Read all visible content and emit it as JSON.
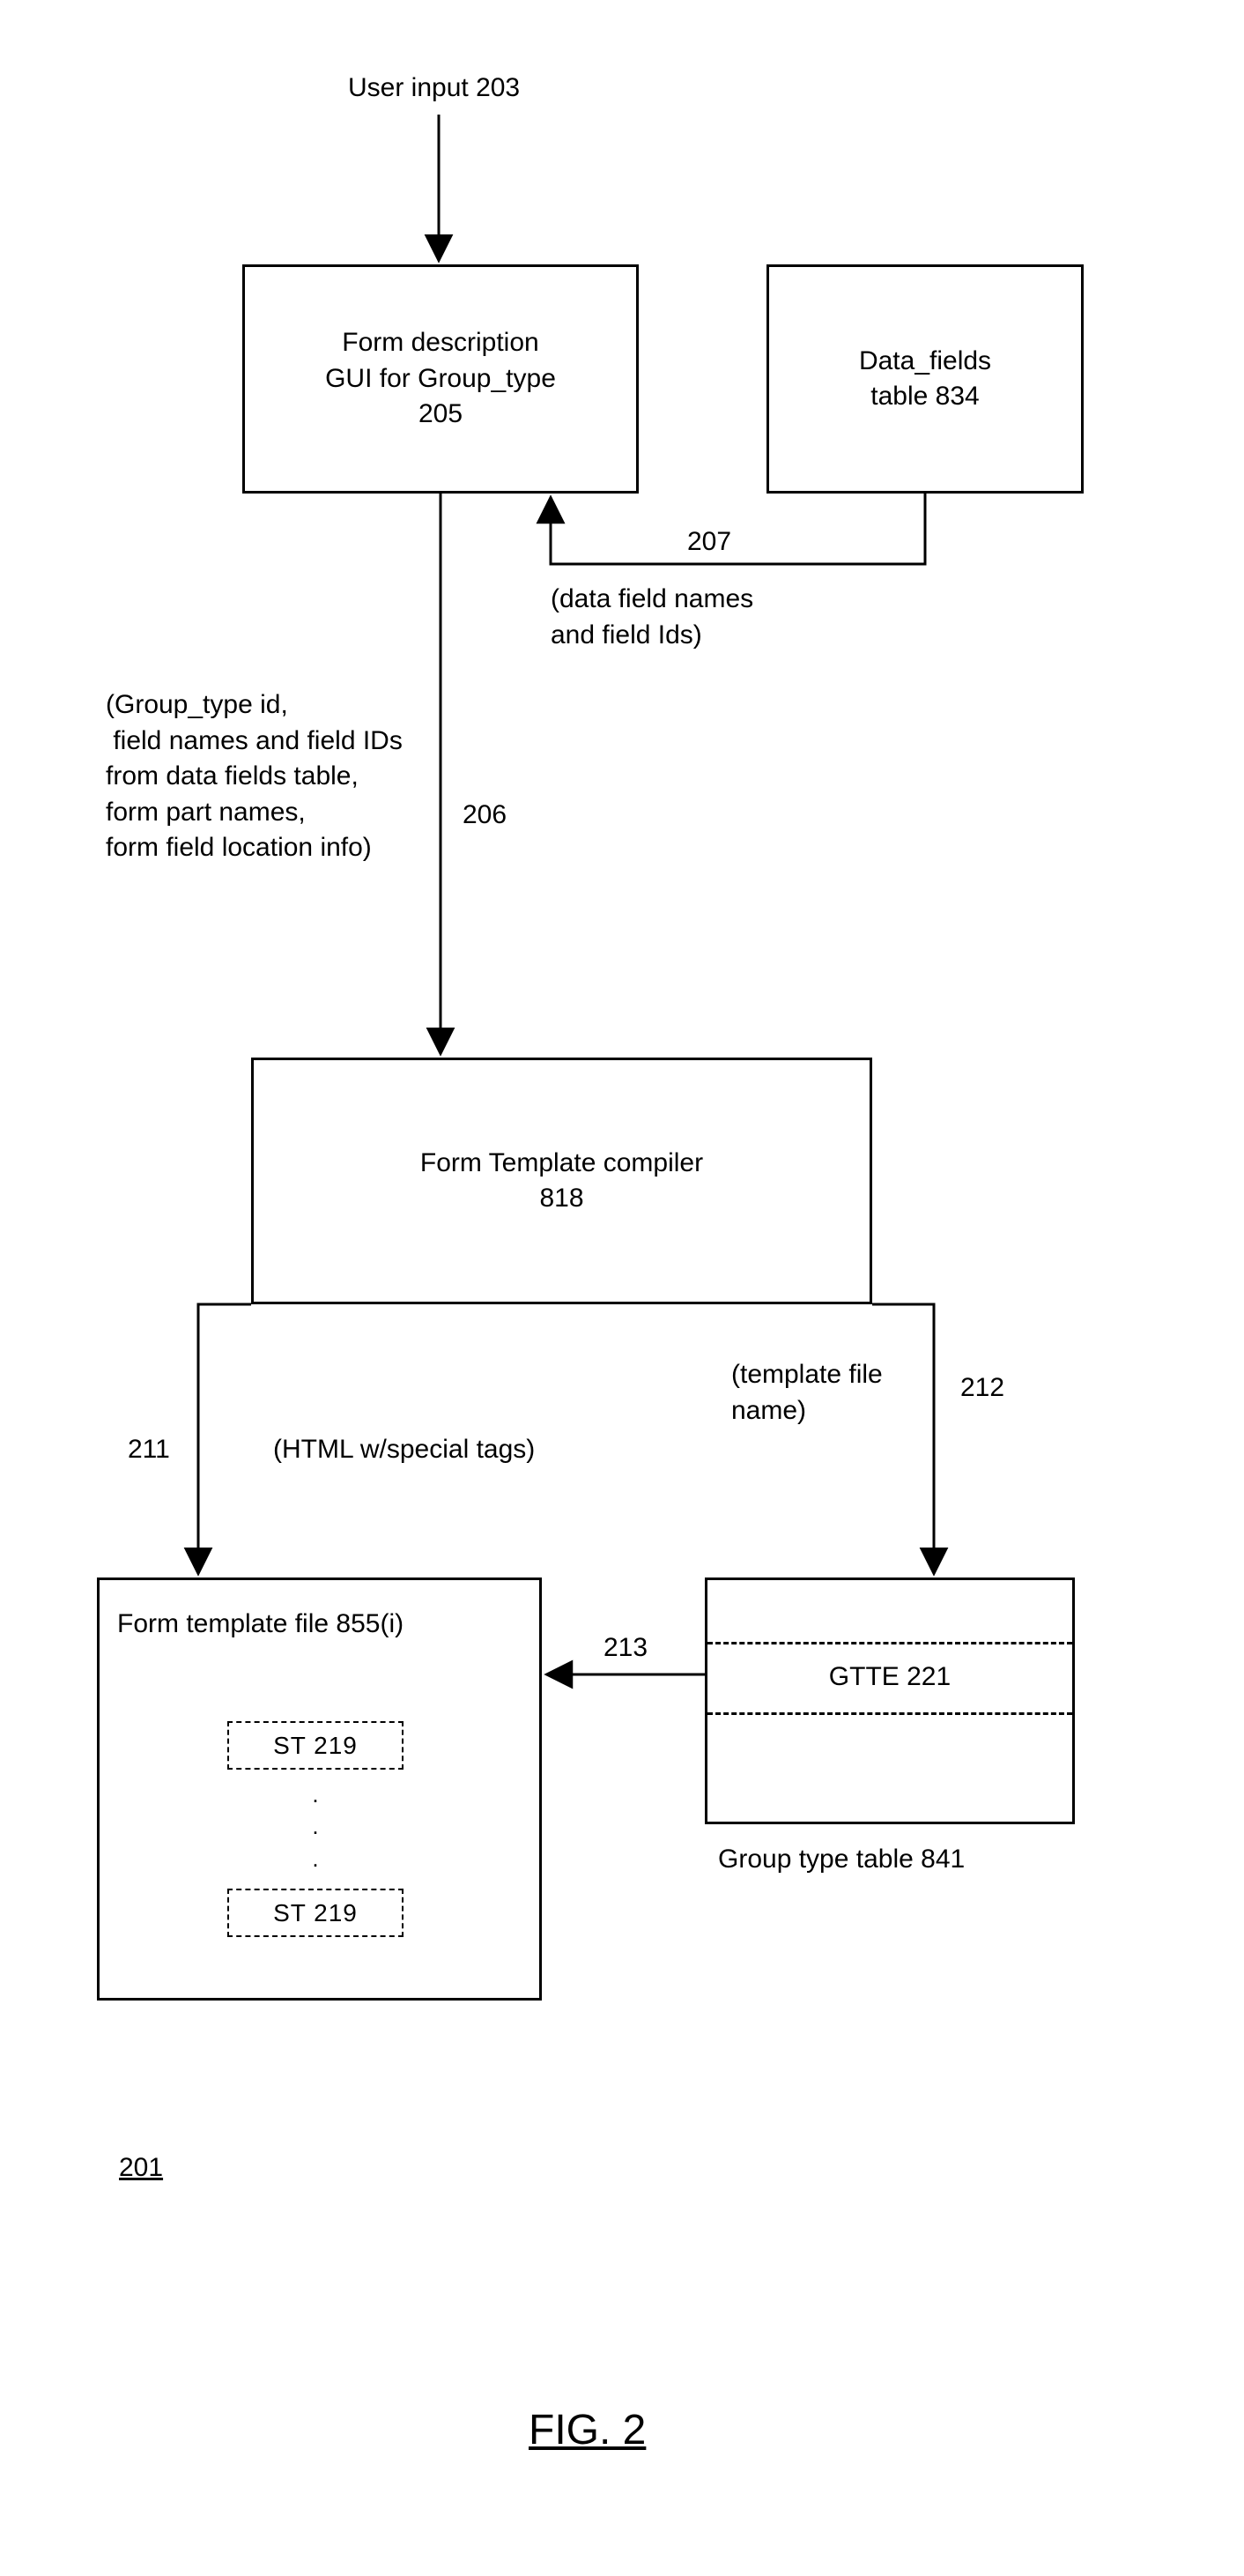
{
  "userInput": "User input 203",
  "formGui": {
    "l1": "Form description",
    "l2": "GUI for Group_type",
    "l3": "205"
  },
  "dataFields": {
    "l1": "Data_fields",
    "l2": "table 834"
  },
  "compiler": {
    "l1": "Form Template compiler",
    "l2": "818"
  },
  "ftFile": {
    "title": "Form template file 855(i)",
    "st": "ST  219"
  },
  "gtTable": {
    "entry": "GTTE 221",
    "caption": "Group type table 841"
  },
  "edge206": {
    "num": "206",
    "text": "(Group_type id,\n field names and field IDs\nfrom data fields table,\nform part names,\nform field location info)"
  },
  "edge207": {
    "num": "207",
    "text": "(data field names\nand field Ids)"
  },
  "edge211": {
    "num": "211",
    "text": "(HTML w/special tags)"
  },
  "edge212": {
    "num": "212",
    "text": "(template file\nname)"
  },
  "edge213": {
    "num": "213"
  },
  "pageRef": "201",
  "figCaption": "FIG. 2"
}
